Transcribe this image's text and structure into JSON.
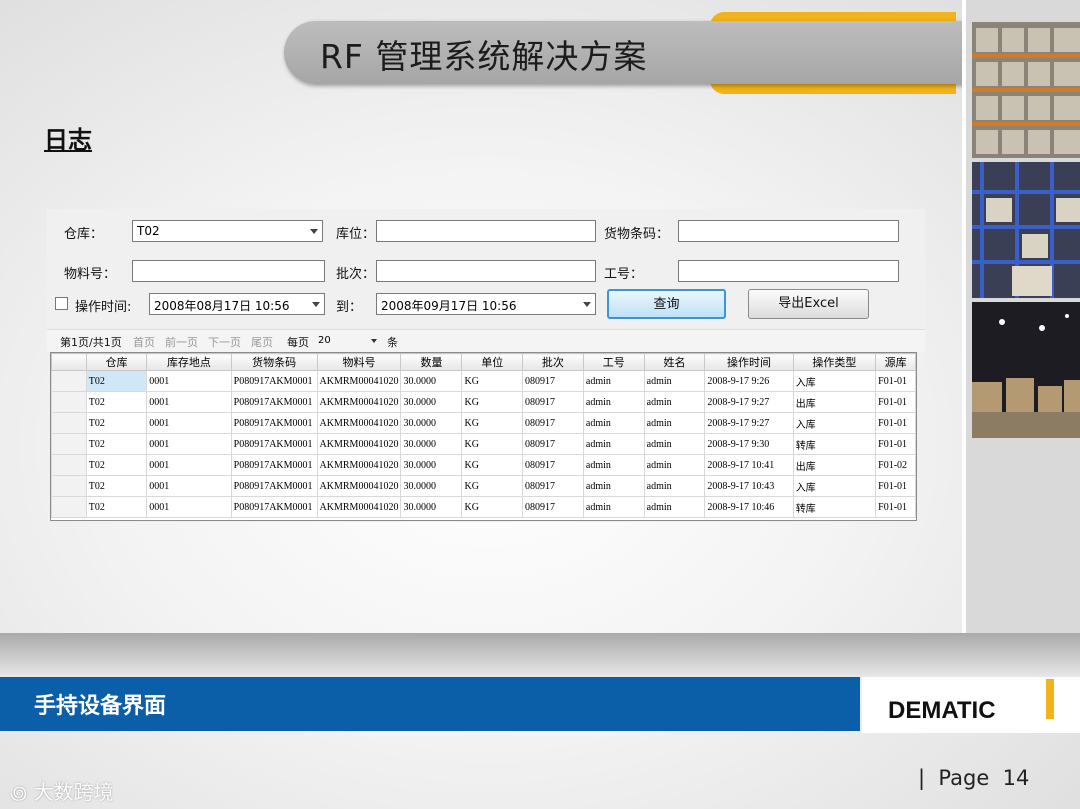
{
  "slide": {
    "title": "RF 管理系统解决方案",
    "section_heading": "日志",
    "footer_title": "手持设备界面",
    "logo_text": "DEMATIC",
    "page_label": "|  Page  14",
    "watermark": "大数跨境"
  },
  "form": {
    "warehouse_label": "仓库：",
    "warehouse_value": "T02",
    "location_label": "库位：",
    "location_value": "",
    "barcode_label": "货物条码：",
    "barcode_value": "",
    "material_label": "物料号：",
    "material_value": "",
    "batch_label": "批次：",
    "batch_value": "",
    "worker_label": "工号：",
    "worker_value": "",
    "optime_label": "操作时间:",
    "from_date": "2008年08月17日 10:56",
    "to_label": "到：",
    "to_date": "2008年09月17日 10:56",
    "query_button": "查询",
    "export_button": "导出Excel"
  },
  "pager": {
    "page_info": "第1页/共1页",
    "first": "首页",
    "prev": "前一页",
    "next": "下一页",
    "last": "尾页",
    "per_page_label": "每页",
    "per_page_value": "20",
    "unit": "条"
  },
  "grid": {
    "columns": [
      "仓库",
      "库存地点",
      "货物条码",
      "物料号",
      "数量",
      "单位",
      "批次",
      "工号",
      "姓名",
      "操作时间",
      "操作类型",
      "源库"
    ],
    "rows": [
      [
        "T02",
        "0001",
        "P080917AKM0001",
        "AKMRM00041020",
        "30.0000",
        "KG",
        "080917",
        "admin",
        "admin",
        "2008-9-17 9:26",
        "入库",
        "F01-01"
      ],
      [
        "T02",
        "0001",
        "P080917AKM0001",
        "AKMRM00041020",
        "30.0000",
        "KG",
        "080917",
        "admin",
        "admin",
        "2008-9-17 9:27",
        "出库",
        "F01-01"
      ],
      [
        "T02",
        "0001",
        "P080917AKM0001",
        "AKMRM00041020",
        "30.0000",
        "KG",
        "080917",
        "admin",
        "admin",
        "2008-9-17 9:27",
        "入库",
        "F01-01"
      ],
      [
        "T02",
        "0001",
        "P080917AKM0001",
        "AKMRM00041020",
        "30.0000",
        "KG",
        "080917",
        "admin",
        "admin",
        "2008-9-17 9:30",
        "转库",
        "F01-01"
      ],
      [
        "T02",
        "0001",
        "P080917AKM0001",
        "AKMRM00041020",
        "30.0000",
        "KG",
        "080917",
        "admin",
        "admin",
        "2008-9-17 10:41",
        "出库",
        "F01-02"
      ],
      [
        "T02",
        "0001",
        "P080917AKM0001",
        "AKMRM00041020",
        "30.0000",
        "KG",
        "080917",
        "admin",
        "admin",
        "2008-9-17 10:43",
        "入库",
        "F01-01"
      ],
      [
        "T02",
        "0001",
        "P080917AKM0001",
        "AKMRM00041020",
        "30.0000",
        "KG",
        "080917",
        "admin",
        "admin",
        "2008-9-17 10:46",
        "转库",
        "F01-01"
      ]
    ]
  },
  "colors": {
    "accent_yellow": "#f2b21a",
    "footer_blue": "#0b5ea8"
  }
}
